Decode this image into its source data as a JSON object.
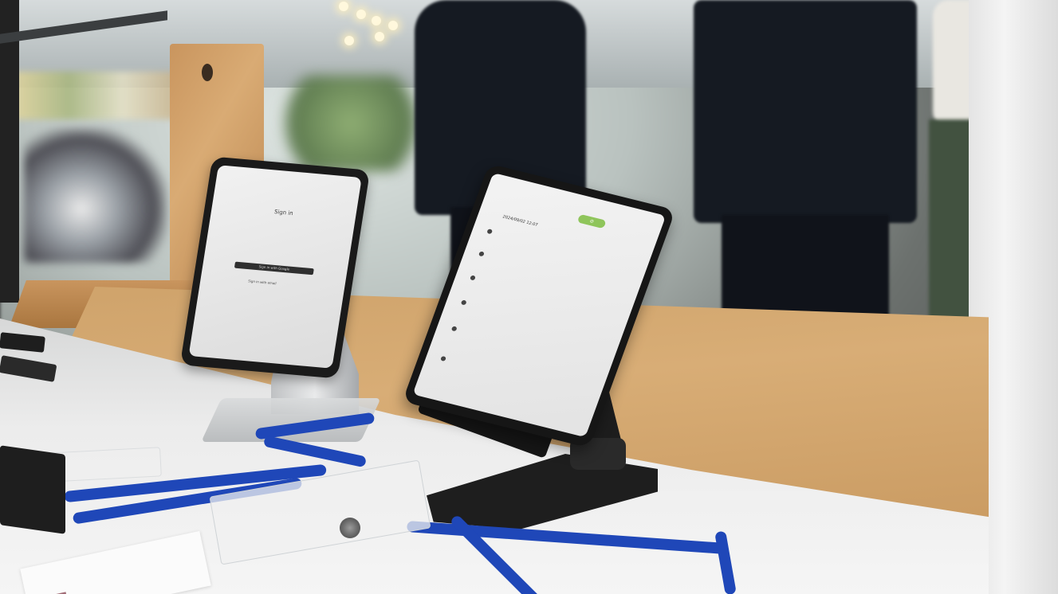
{
  "scene": {
    "description_colors": {
      "table_wood": "#cfa36b",
      "table_white": "#ececec",
      "lanyard_blue": "#1f47b8",
      "phone_body": "#161616",
      "screen_accent_green": "#8fc55b"
    }
  },
  "phone_left": {
    "title": "Sign in",
    "button_label": "Sign in with Google",
    "secondary_label": "Sign in with email"
  },
  "phone_right": {
    "pill_label": "⊘",
    "header_time": "2024/09/02 12:07"
  }
}
